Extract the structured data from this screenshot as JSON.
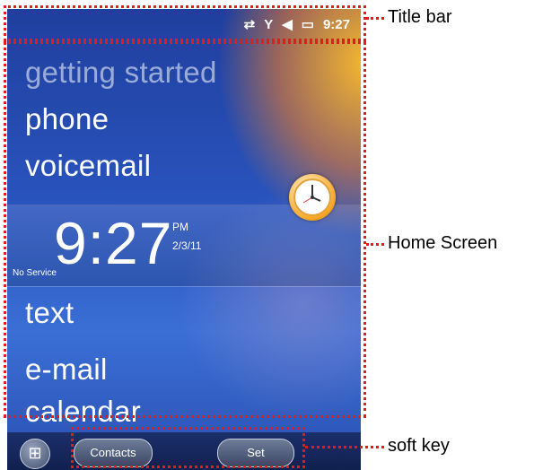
{
  "status_bar": {
    "icons": [
      "data-transfer-icon",
      "signal-icon",
      "speaker-mute-icon",
      "battery-icon"
    ],
    "time": "9:27"
  },
  "menu": {
    "items": [
      "getting started",
      "phone",
      "voicemail",
      "text",
      "e-mail",
      "calendar"
    ]
  },
  "clock": {
    "time": "9:27",
    "ampm": "PM",
    "date": "2/3/11",
    "service": "No Service"
  },
  "softkeys": {
    "left": "Contacts",
    "right": "Set"
  },
  "annotations": {
    "title_bar": "Title bar",
    "home_screen": "Home Screen",
    "soft_key": "soft key"
  },
  "colors": {
    "annotation": "#e21b1b",
    "screen_blue": "#2a55bf",
    "sun_orange": "#ffbe28"
  }
}
